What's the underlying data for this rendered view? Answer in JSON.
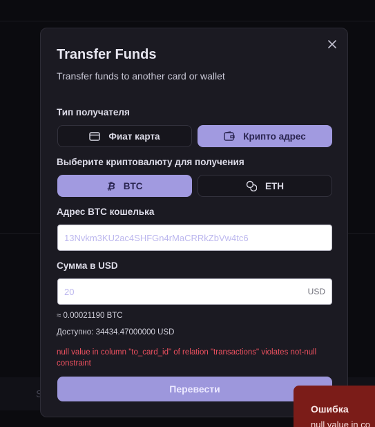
{
  "modal": {
    "title": "Transfer Funds",
    "subtitle": "Transfer funds to another card or wallet",
    "close_icon": "close-icon"
  },
  "recipient_type": {
    "label": "Тип получателя",
    "options": [
      {
        "label": "Фиат карта",
        "icon": "credit-card-icon",
        "selected": false
      },
      {
        "label": "Крипто адрес",
        "icon": "wallet-icon",
        "selected": true
      }
    ]
  },
  "crypto": {
    "label": "Выберите криптовалюту для получения",
    "options": [
      {
        "label": "BTC",
        "icon": "bitcoin-icon",
        "selected": true
      },
      {
        "label": "ETH",
        "icon": "coins-icon",
        "selected": false
      }
    ]
  },
  "wallet_address": {
    "label": "Адрес BTC кошелька",
    "placeholder": "13Nvkm3KU2ac4SHFGn4rMaCRRkZbVw4tc6",
    "value": ""
  },
  "amount": {
    "label": "Сумма в USD",
    "placeholder": "20",
    "value": "",
    "suffix": "USD",
    "converted": "≈ 0.00021190 BTC",
    "available": "Доступно: 34434.47000000 USD"
  },
  "error": "null value in column \"to_card_id\" of relation \"transactions\" violates not-null constraint",
  "submit_label": "Перевести",
  "toast": {
    "title": "Ошибка",
    "body": "null value in co"
  },
  "colors": {
    "accent": "#a19ae0",
    "error": "#ee5160",
    "toast_bg": "#7b1c18"
  }
}
